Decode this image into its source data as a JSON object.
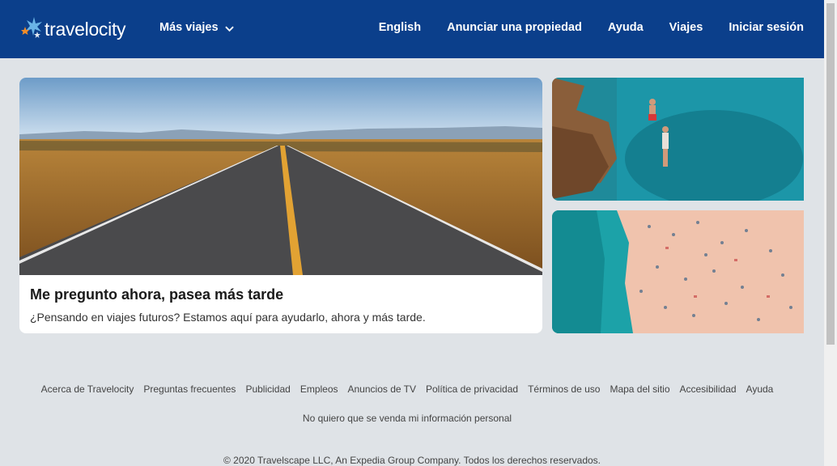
{
  "header": {
    "logo_text": "travelocity",
    "more_trips_label": "Más viajes",
    "nav": [
      {
        "label": "English"
      },
      {
        "label": "Anunciar una propiedad"
      },
      {
        "label": "Ayuda"
      },
      {
        "label": "Viajes"
      },
      {
        "label": "Iniciar sesión"
      }
    ]
  },
  "hero": {
    "title": "Me pregunto ahora, pasea más tarde",
    "subtitle": "¿Pensando en viajes futuros? Estamos aquí para ayudarlo, ahora y más tarde."
  },
  "footer": {
    "links": [
      {
        "label": "Acerca de Travelocity"
      },
      {
        "label": "Preguntas frecuentes"
      },
      {
        "label": "Publicidad"
      },
      {
        "label": "Empleos"
      },
      {
        "label": "Anuncios de TV"
      },
      {
        "label": "Política de privacidad"
      },
      {
        "label": "Términos de uso"
      },
      {
        "label": "Mapa del sitio"
      },
      {
        "label": "Accesibilidad"
      },
      {
        "label": "Ayuda"
      }
    ],
    "privacy_opt_out": "No quiero que se venda mi información personal",
    "copyright": "© 2020 Travelscape LLC, An Expedia Group Company. Todos los derechos reservados."
  },
  "colors": {
    "header_bg": "#0b3f8b",
    "page_bg": "#dfe3e7",
    "logo_star_orange": "#f28c28",
    "logo_star_blue": "#6ab4e6"
  },
  "icons": {
    "logo": "travelocity-star-logo-icon",
    "dropdown": "chevron-down-icon"
  }
}
